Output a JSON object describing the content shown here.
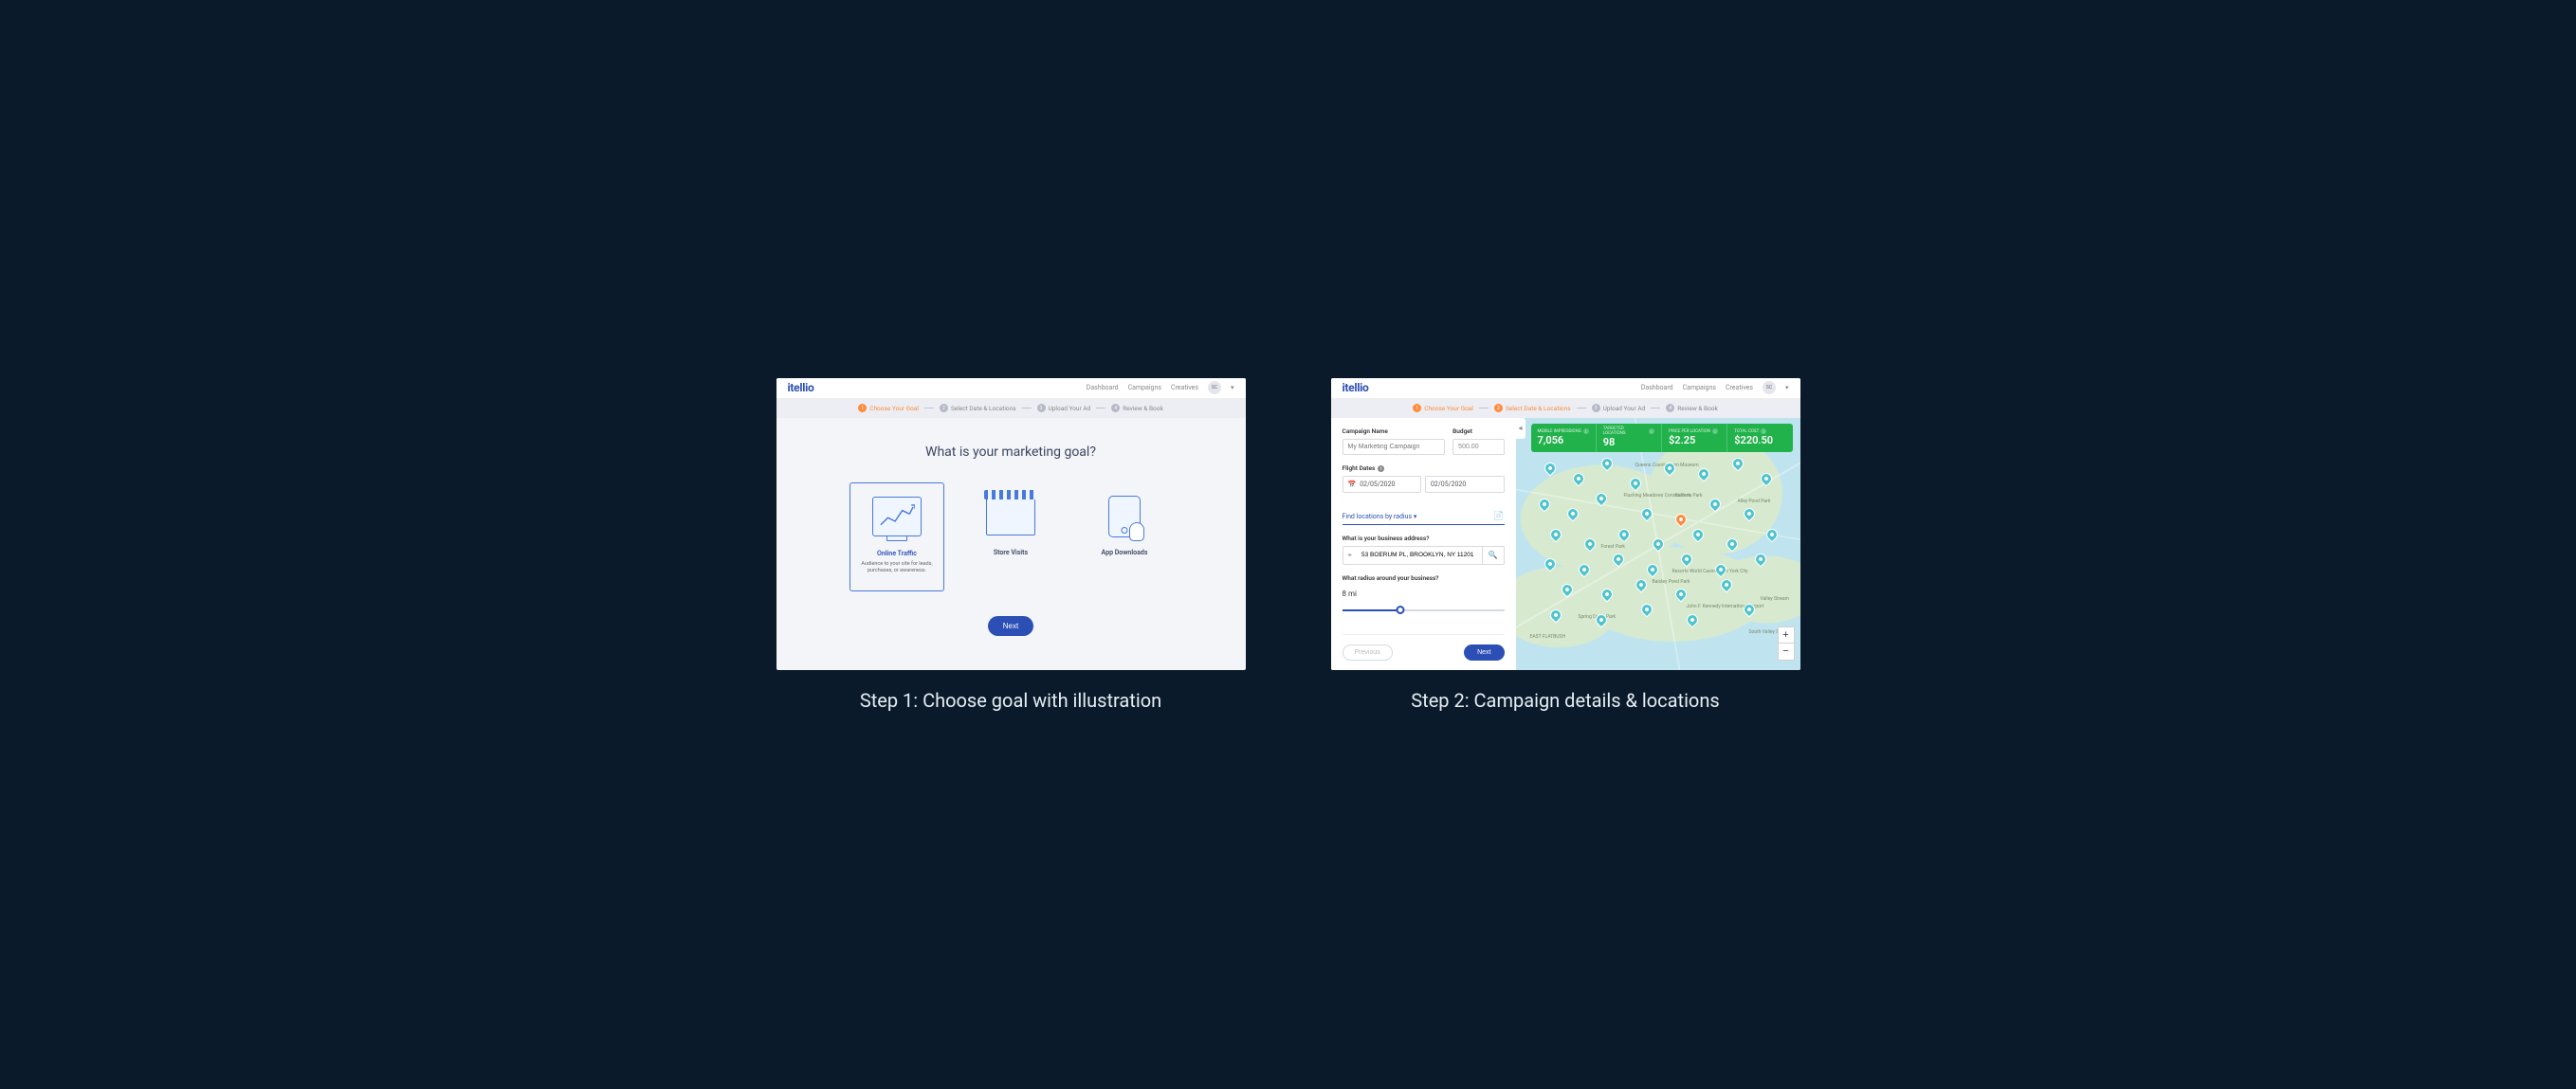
{
  "brand": "itellio",
  "nav": {
    "dashboard": "Dashboard",
    "campaigns": "Campaigns",
    "creatives": "Creatives",
    "avatar_initials": "SC"
  },
  "stepper": [
    {
      "num": "1",
      "label": "Choose Your Goal"
    },
    {
      "num": "2",
      "label": "Select Date & Locations"
    },
    {
      "num": "3",
      "label": "Upload Your Ad"
    },
    {
      "num": "4",
      "label": "Review & Book"
    }
  ],
  "step1": {
    "heading": "What is your marketing goal?",
    "goals": [
      {
        "title": "Online Traffic",
        "desc": "Audience to your site for leads, purchases, or awareness.",
        "selected": true
      },
      {
        "title": "Store Visits",
        "desc": ""
      },
      {
        "title": "App Downloads",
        "desc": ""
      }
    ],
    "next": "Next"
  },
  "step2": {
    "campaign_name_label": "Campaign Name",
    "campaign_name_placeholder": "My Marketing Campaign",
    "budget_label": "Budget",
    "budget_value": "500.00",
    "flight_dates_label": "Flight Dates",
    "date_start": "02/05/2020",
    "date_end": "02/05/2020",
    "find_locations_label": "Find locations by radius",
    "address_label": "What is your business address?",
    "address_value": "53 BOERUM PL, BROOKLYN, NY 11201",
    "radius_label": "What radius around your business?",
    "radius_value": "8 mi",
    "previous": "Previous",
    "next": "Next",
    "stats": [
      {
        "label": "MOBILE IMPRESSIONS",
        "value": "7,056"
      },
      {
        "label": "TARGETED LOCATIONS",
        "value": "98"
      },
      {
        "label": "PRICE PER LOCATION",
        "value": "$2.25"
      },
      {
        "label": "TOTAL COST",
        "value": "$220.50"
      }
    ],
    "map_labels": [
      "Queens County Farm Museum",
      "Flushing Meadows Corona Park",
      "Forest Park",
      "Alley Pond Park",
      "Kissena Park",
      "John F. Kennedy International Airport",
      "South Valley Stream",
      "Baisley Pond Park",
      "Resorts World Casino New York City",
      "Spring Creek Park",
      "EAST FLATBUSH",
      "Valley Stream"
    ],
    "zoom_in": "+",
    "zoom_out": "−"
  },
  "captions": {
    "c1": "Step 1: Choose goal with illustration",
    "c2": "Step 2: Campaign details & locations"
  }
}
